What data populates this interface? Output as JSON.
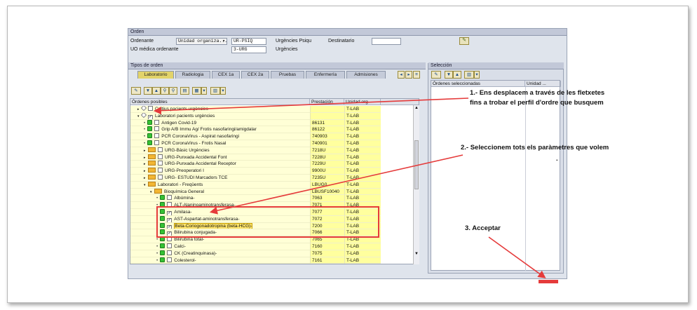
{
  "orden": {
    "title": "Orden",
    "ordenante_label": "Ordenante",
    "ordenante_type": "Unidad organiza...",
    "ordenante_code": "UR-PSIQ",
    "ordenante_name": "Urgències Psiqu",
    "destinatario_label": "Destinatario",
    "destinatario_value": "",
    "uo_label": "UO médica ordenante",
    "uo_code": "3-URG",
    "uo_name": "Urgències"
  },
  "tipos": {
    "title": "Tipos de orden",
    "tabs": [
      "Laboratorio",
      "Radiologia",
      "CEX 1a",
      "CEX 2a",
      "Pruebas",
      "Enfermería",
      "Admisiones"
    ]
  },
  "grid": {
    "col_name": "Órdenes posibles",
    "col_prest": "Prestación",
    "col_unit": "Unidad org",
    "rows": [
      {
        "name": "Cultius pacients urgències",
        "prest": "",
        "unit": "T-LAB"
      },
      {
        "name": "Laboratori pacients urgències",
        "prest": "",
        "unit": "T-LAB"
      },
      {
        "name": "Antigen Covid-19",
        "prest": "86131",
        "unit": "T-LAB"
      },
      {
        "name": "Grip A/B Immu Ag/ Frotis nasofaringi/amigdalar",
        "prest": "86122",
        "unit": "T-LAB"
      },
      {
        "name": "PCR CoronaVirus - Aspirat nasofaringi",
        "prest": "740903",
        "unit": "T-LAB"
      },
      {
        "name": "PCR CoronaVirus - Frotis Nasal",
        "prest": "740901",
        "unit": "T-LAB"
      },
      {
        "name": "URG-Bàsic Urgències",
        "prest": "7218U",
        "unit": "T-LAB"
      },
      {
        "name": "URG-Punxada Accidental Font",
        "prest": "7228U",
        "unit": "T-LAB"
      },
      {
        "name": "URG-Punxada Accidental Receptor",
        "prest": "7229U",
        "unit": "T-LAB"
      },
      {
        "name": "URG-Preoperatori I",
        "prest": "9900U",
        "unit": "T-LAB"
      },
      {
        "name": "URG- ESTUDI Marcadors TCE",
        "prest": "7235U",
        "unit": "T-LAB"
      },
      {
        "name": "Laboratori - Freqüents",
        "prest": "LBUG0",
        "unit": "T-LAB"
      },
      {
        "name": "Bioquímica General",
        "prest": "LBUSF10040",
        "unit": "T-LAB"
      },
      {
        "name": "Albúmina-",
        "prest": "7063",
        "unit": "T-LAB"
      },
      {
        "name": "ALT-Alaninoaminotransferasa-",
        "prest": "7071",
        "unit": "T-LAB"
      },
      {
        "name": "Amilasa-",
        "prest": "7077",
        "unit": "T-LAB"
      },
      {
        "name": "AST-Aspartat-aminotransferasa-",
        "prest": "7072",
        "unit": "T-LAB"
      },
      {
        "name": "Beta-Coriogonadotropina (beta-HCG)-",
        "prest": "7200",
        "unit": "T-LAB"
      },
      {
        "name": "Bilirubina conjugada-",
        "prest": "7066",
        "unit": "T-LAB"
      },
      {
        "name": "Bilirubina total-",
        "prest": "7065",
        "unit": "T-LAB"
      },
      {
        "name": "Calci-",
        "prest": "7160",
        "unit": "T-LAB"
      },
      {
        "name": "CK (Creatinquinasa)-",
        "prest": "7075",
        "unit": "T-LAB"
      },
      {
        "name": "Colesterol-",
        "prest": "7161",
        "unit": "T-LAB"
      }
    ]
  },
  "seleccion": {
    "title": "Selección",
    "col_name": "Órdenes seleccionadas",
    "col_unit": "Unidad ..."
  },
  "annotations": {
    "step1_line1": "1.- Ens desplacem a través de les fletxetes",
    "step1_line2": "fins a trobar el perfil d'ordre que busquem",
    "step2": "2.- Seleccionem tots els paràmetres que volem",
    "step3": "3. Acceptar"
  },
  "colors": {
    "annotation_red": "#e53b3b",
    "active_tab": "#e2d36a",
    "row_yellow": "#ffff9e"
  }
}
